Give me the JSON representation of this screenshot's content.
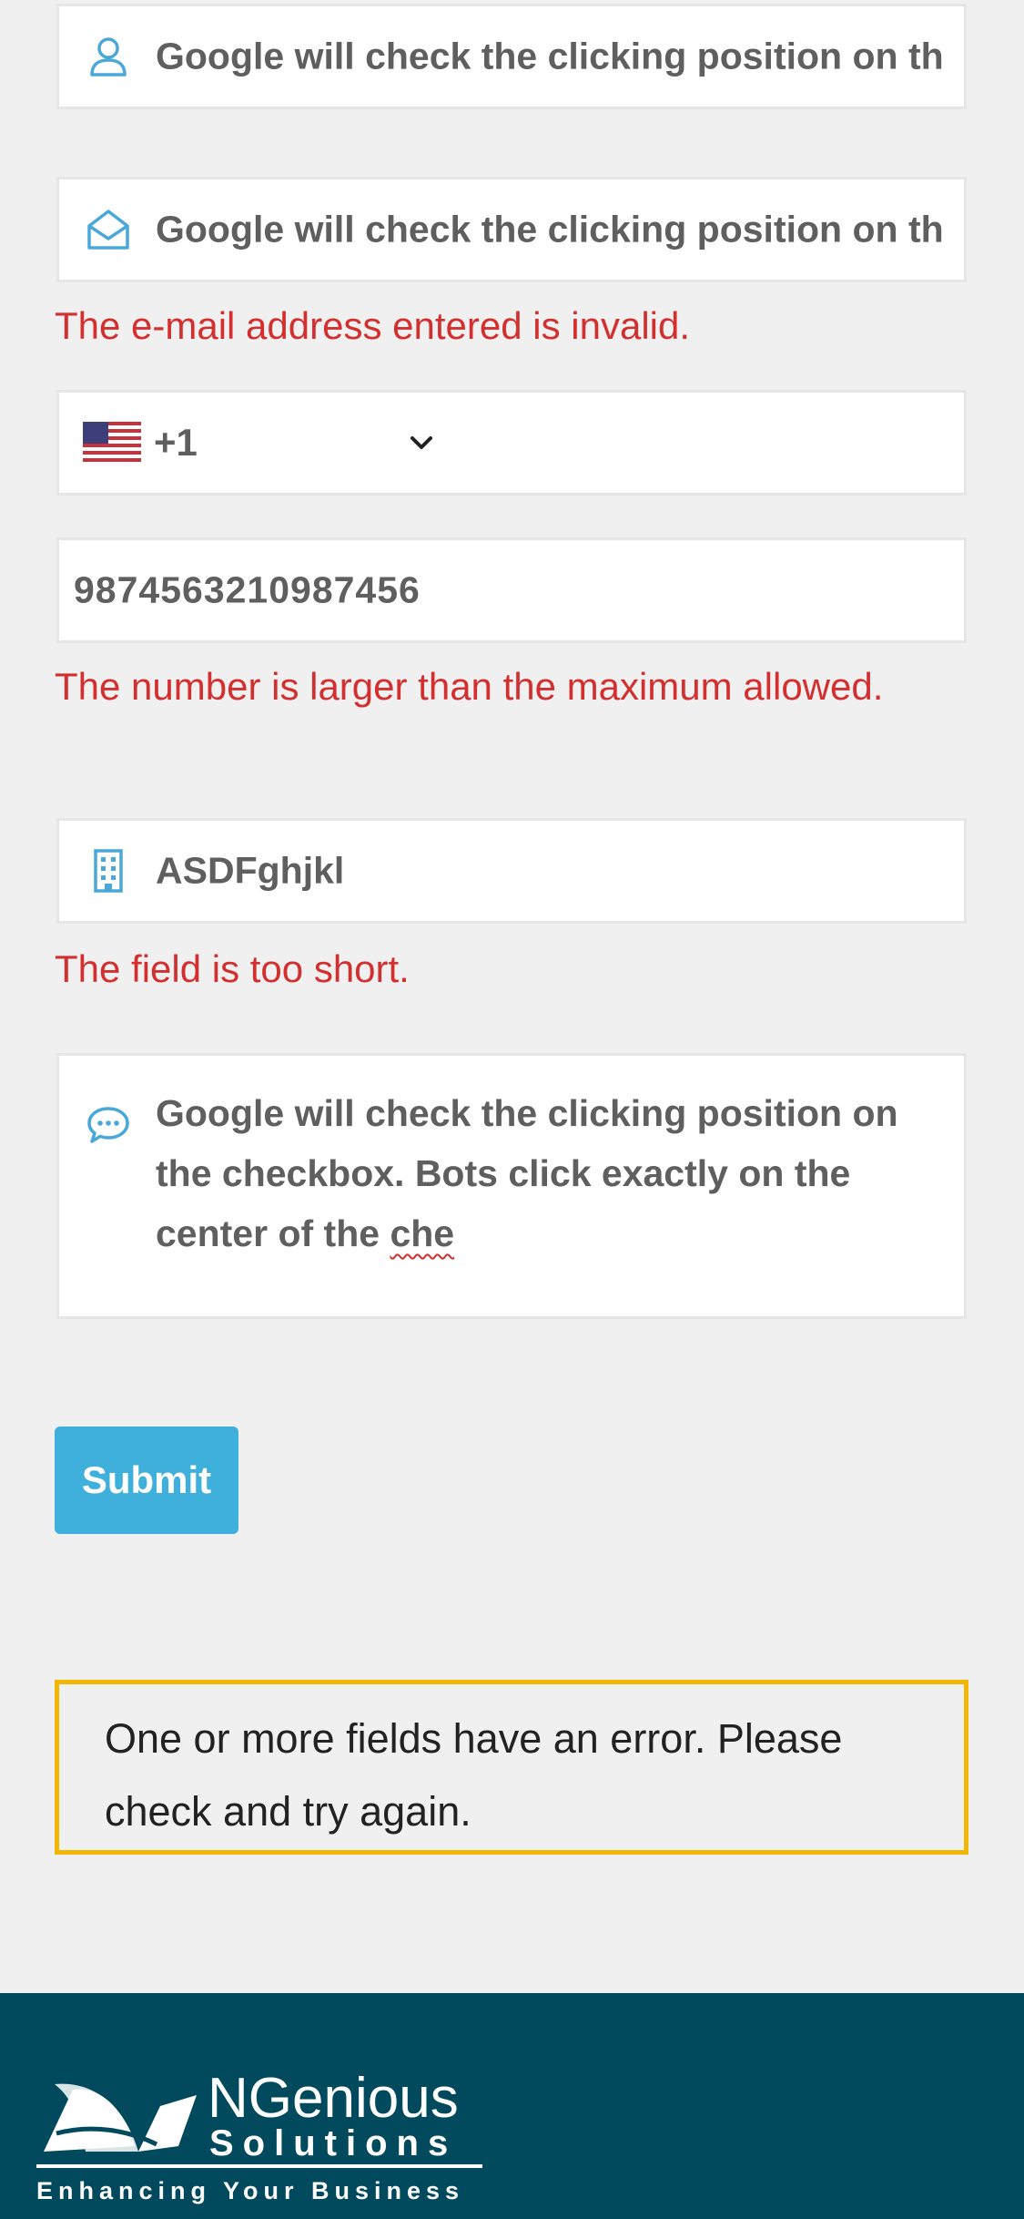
{
  "form": {
    "name_value": "Google will check the clicking position on th",
    "email_value": "Google will check the clicking position on th",
    "email_error": "The e-mail address entered is invalid.",
    "phone_country_code": "+1",
    "number_value": "9874563210987456",
    "number_error": "The number is larger than the maximum allowed.",
    "company_value": "ASDFghjkl",
    "company_error": "The field is too short.",
    "message_text_main": "Google will check the clicking position on the checkbox. Bots click exactly on the center of the ",
    "message_text_misspelled": "che",
    "submit_label": "Submit"
  },
  "alert": {
    "message": "One or more fields have an error. Please check and try again."
  },
  "footer": {
    "logo_title": "NGenious",
    "logo_subtitle": "Solutions",
    "logo_tagline": "Enhancing Your Business"
  },
  "icons": {
    "name": "user-icon",
    "email": "envelope-open-icon",
    "phone_flag": "us-flag-icon",
    "phone_dropdown": "chevron-down-icon",
    "company": "building-icon",
    "message": "speech-bubble-icon"
  },
  "colors": {
    "background": "#f0f0f0",
    "error": "#d32f2f",
    "icon": "#4aa8d8",
    "submit": "#3fb0dc",
    "alert_border": "#f2b705",
    "footer": "#014a5e"
  }
}
